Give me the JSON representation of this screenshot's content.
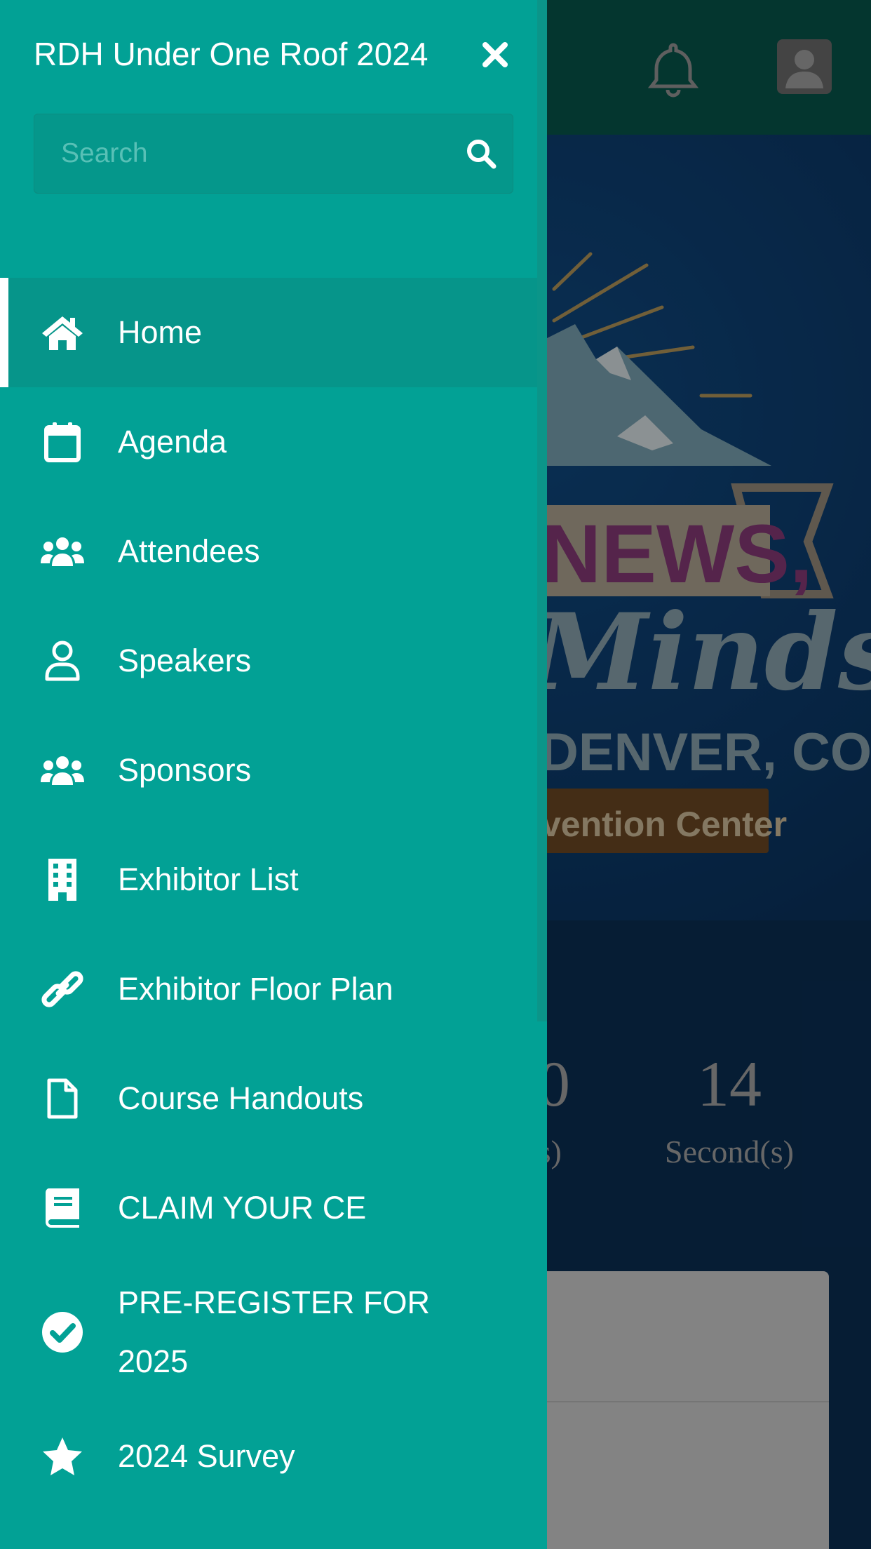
{
  "app": {
    "title": "RDH Under One Roof 2024"
  },
  "search": {
    "placeholder": "Search",
    "value": ""
  },
  "menu": {
    "items": [
      {
        "label": "Home",
        "icon": "home-icon"
      },
      {
        "label": "Agenda",
        "icon": "calendar-icon"
      },
      {
        "label": "Attendees",
        "icon": "users-icon"
      },
      {
        "label": "Speakers",
        "icon": "user-icon"
      },
      {
        "label": "Sponsors",
        "icon": "users-icon"
      },
      {
        "label": "Exhibitor List",
        "icon": "building-icon"
      },
      {
        "label": "Exhibitor Floor Plan",
        "icon": "link-icon"
      },
      {
        "label": "Course Handouts",
        "icon": "file-icon"
      },
      {
        "label": "CLAIM YOUR CE",
        "icon": "book-icon"
      },
      {
        "label": "PRE-REGISTER FOR 2025",
        "icon": "check-circle-icon"
      },
      {
        "label": "2024 Survey",
        "icon": "star-icon"
      }
    ],
    "active_index": 0
  },
  "background": {
    "logo_text": [
      "NEWS,",
      "Minds",
      "DENVER, CO",
      "vention Center"
    ],
    "countdown": {
      "minutes_digit_partial": "0",
      "minutes_label_partial": "te(s)",
      "seconds_value": "14",
      "seconds_label": "Second(s)"
    }
  },
  "colors": {
    "drawer": "#02a195",
    "header": "#07574c",
    "hero": "#0c3c6e"
  }
}
